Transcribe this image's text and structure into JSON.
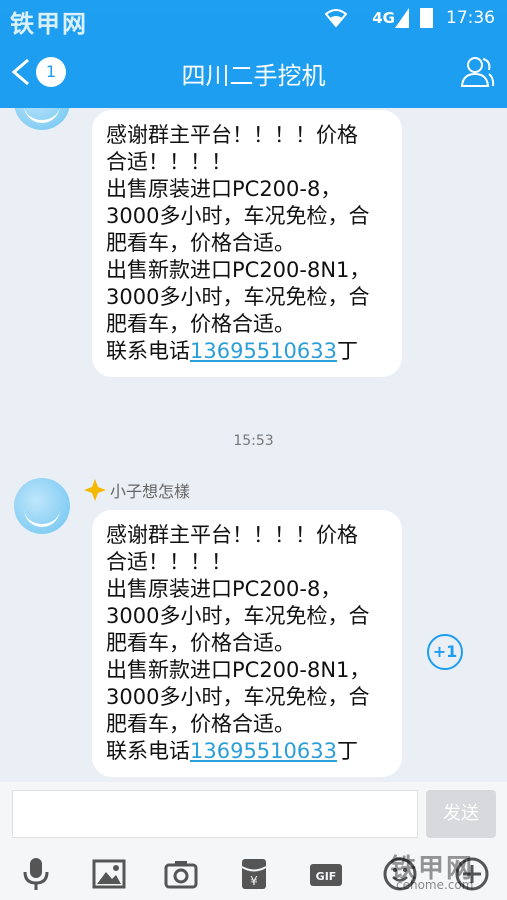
{
  "status_bar": {
    "network": "4G",
    "time": "17:36"
  },
  "watermark": {
    "brand": "铁甲网",
    "site": "cehome.com"
  },
  "header": {
    "unread_count": "1",
    "title": "四川二手挖机"
  },
  "messages": [
    {
      "lines": [
        "感谢群主平台！！！！价格",
        "合适！！！！",
        "出售原装进口PC200-8，",
        "3000多小时，车况免检，合",
        "肥看车，价格合适。",
        "出售新款进口PC200-8N1，",
        "3000多小时，车况免检，合",
        "肥看车，价格合适。"
      ],
      "contact_prefix": "联系电话",
      "phone": "13695510633",
      "contact_suffix": "丁"
    },
    {
      "timestamp": "15:53",
      "sender": "小子想怎樣",
      "lines": [
        "感谢群主平台！！！！价格",
        "合适！！！！",
        "出售原装进口PC200-8，",
        "3000多小时，车况免检，合",
        "肥看车，价格合适。",
        "出售新款进口PC200-8N1，",
        "3000多小时，车况免检，合",
        "肥看车，价格合适。"
      ],
      "contact_prefix": "联系电话",
      "phone": "13695510633",
      "contact_suffix": "丁",
      "plus_one": "+1"
    }
  ],
  "composer": {
    "send_label": "发送",
    "tools": [
      "microphone-icon",
      "image-icon",
      "camera-icon",
      "red-packet-icon",
      "gif-icon",
      "emoji-icon",
      "plus-icon"
    ]
  },
  "colors": {
    "accent": "#1d9ef0",
    "link": "#2b9fd8",
    "background": "#eaeef5"
  }
}
